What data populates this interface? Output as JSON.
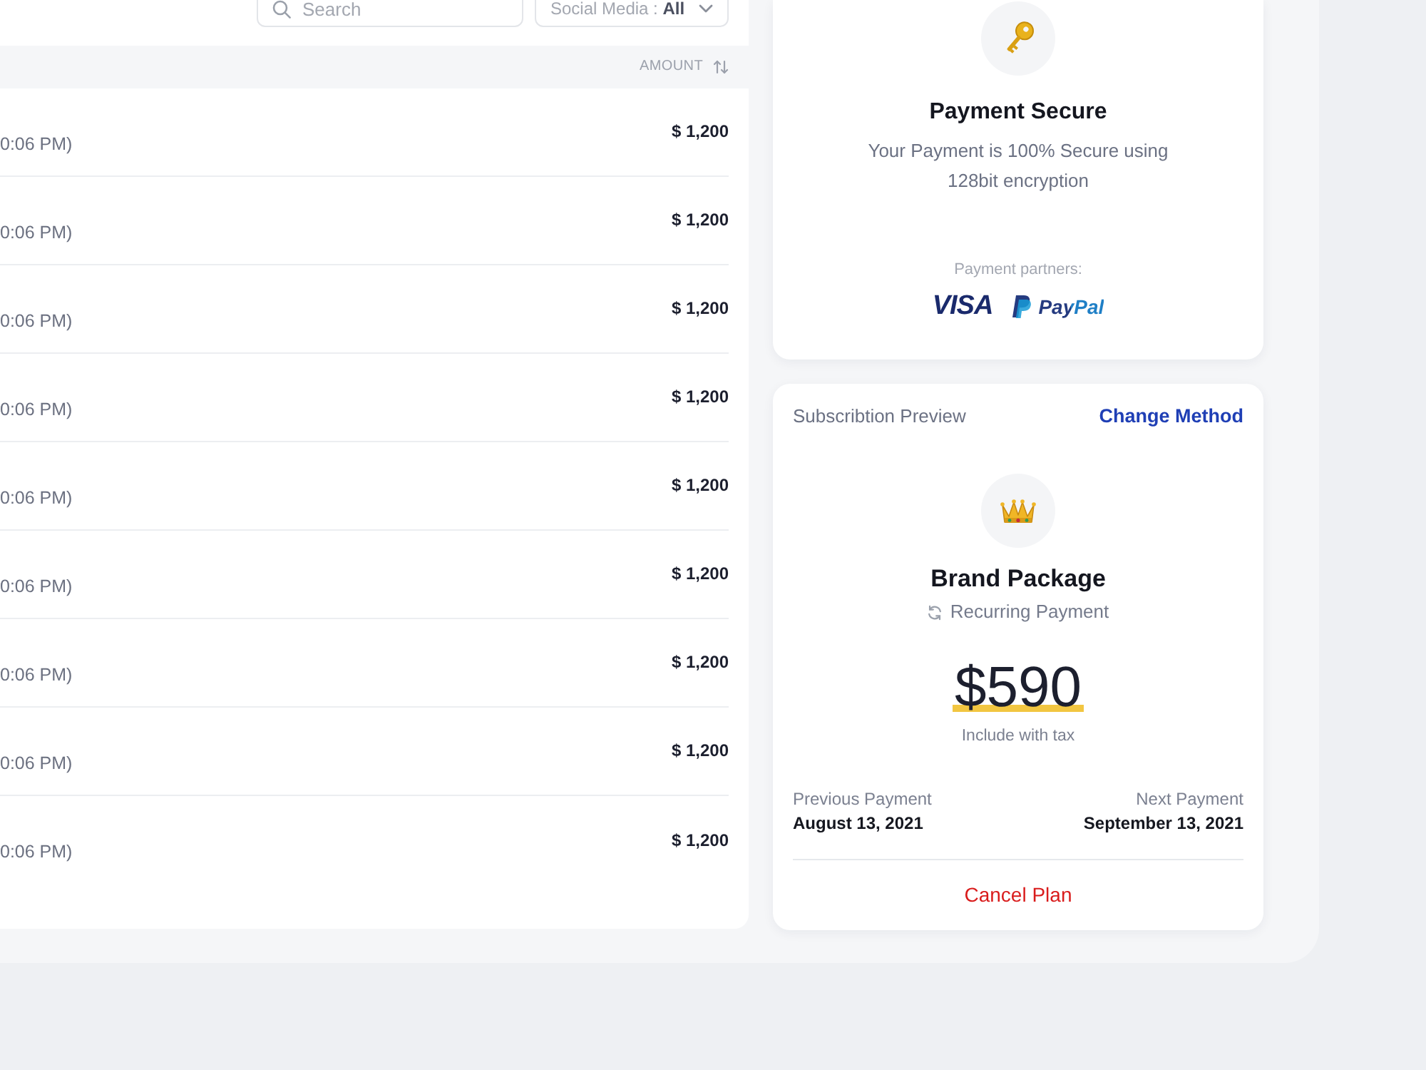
{
  "toolbar": {
    "search": {
      "placeholder": "Search"
    },
    "filter": "Social Media : **All**"
  },
  "table": {
    "amount_header": "AMOUNT",
    "rows": [
      {
        "column_1": "0:06 PM)",
        "amount": "$ 1,200"
      },
      {
        "column_1": "0:06 PM)",
        "amount": "$ 1,200"
      },
      {
        "column_1": "0:06 PM)",
        "amount": "$ 1,200"
      },
      {
        "column_1": "0:06 PM)",
        "amount": "$ 1,200"
      },
      {
        "column_1": "0:06 PM)",
        "amount": "$ 1,200"
      },
      {
        "column_1": "0:06 PM)",
        "amount": "$ 1,200"
      },
      {
        "column_1": "0:06 PM)",
        "amount": "$ 1,200"
      },
      {
        "column_1": "0:06 PM)",
        "amount": "$ 1,200"
      },
      {
        "column_1": "0:06 PM)",
        "amount": "$ 1,200"
      }
    ]
  },
  "security": {
    "title": "Payment Secure",
    "description": "Your Payment is 100% Secure using 128bit encryption",
    "partners_label": "Payment partners:",
    "partners": [
      {
        "kind": "wordmark",
        "name": "VISA"
      },
      {
        "kind": "mark_wordmark",
        "name": "PayPal"
      }
    ]
  },
  "subscription": {
    "header": "Subscribtion Preview",
    "action": "Change Method",
    "plan": "Brand Package",
    "billing": "Recurring Payment",
    "price": "$590",
    "price_note": "Include with tax",
    "previous": {
      "label": "Previous Payment",
      "date": "August 13, 2021"
    },
    "next": {
      "label": "Next Payment",
      "date": "September 13, 2021"
    },
    "cancel": "Cancel Plan"
  }
}
